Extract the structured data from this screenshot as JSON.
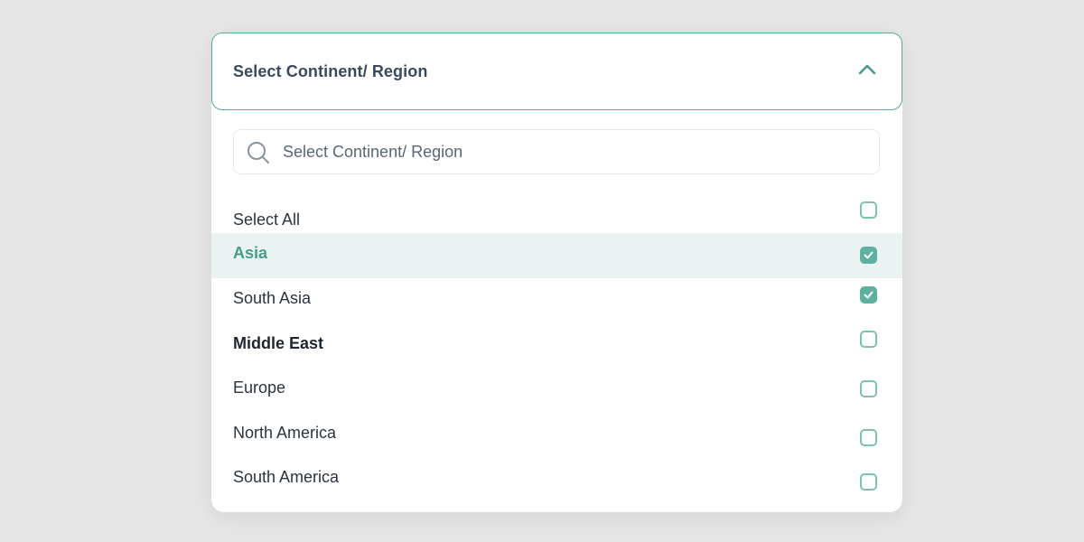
{
  "header": {
    "label": "Select Continent/ Region",
    "chevron_icon": "chevron-up-icon"
  },
  "search": {
    "placeholder": "Select Continent/ Region",
    "value": "",
    "icon": "search-icon"
  },
  "options": [
    {
      "label": "Select All",
      "checked": false,
      "highlighted": false
    },
    {
      "label": "Asia",
      "checked": true,
      "highlighted": true
    },
    {
      "label": "South Asia",
      "checked": true,
      "highlighted": false
    },
    {
      "label": "Middle East",
      "checked": false,
      "highlighted": false
    },
    {
      "label": "Europe",
      "checked": false,
      "highlighted": false
    },
    {
      "label": "North America",
      "checked": false,
      "highlighted": false
    },
    {
      "label": "South America",
      "checked": false,
      "highlighted": false
    }
  ],
  "colors": {
    "accent": "#5eb0a0",
    "border_accent": "#5aa89b",
    "highlight_bg": "#eaf3f1",
    "highlight_text": "#4a9a8b",
    "background": "#e6e6e6"
  }
}
